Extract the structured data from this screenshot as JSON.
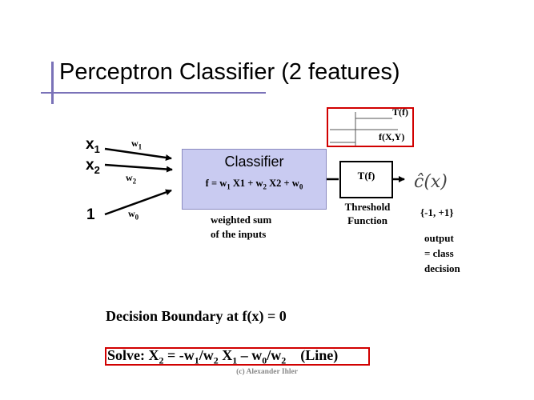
{
  "slide": {
    "title": "Perceptron Classifier (2 features)",
    "copyright": "(c) Alexander Ihler"
  },
  "inputs": [
    {
      "base": "x",
      "sub": "1"
    },
    {
      "base": "x",
      "sub": "2"
    },
    {
      "base": "1",
      "sub": ""
    }
  ],
  "weights": [
    {
      "base": "w",
      "sub": "1"
    },
    {
      "base": "w",
      "sub": "2"
    },
    {
      "base": "w",
      "sub": "0"
    }
  ],
  "classifier": {
    "title": "Classifier",
    "formula": {
      "p1": "f = w",
      "s1": "1",
      "p2": " X1 + w",
      "s2": "2",
      "p3": " X2 + w",
      "s3": "0"
    },
    "caption_line1": "weighted sum",
    "caption_line2": "of the inputs"
  },
  "threshold": {
    "box_label": "T(f)",
    "caption_line1": "Threshold",
    "caption_line2": "Function"
  },
  "step_inset": {
    "t_label": "T(f)",
    "f_label": "f(X,Y)"
  },
  "output": {
    "symbol": "ĉ(x)",
    "range": "{-1, +1}",
    "line1": "output",
    "line2": "= class",
    "line3": "decision"
  },
  "decision_boundary": "Decision Boundary at  f(x) = 0",
  "solve": {
    "p1": "Solve:  X",
    "s1": "2",
    "p2": " = -w",
    "s2": "1",
    "p3": "/w",
    "s3": "2",
    "p4": " X",
    "s4": "1",
    "p5": " – w",
    "s5": "0",
    "p6": "/w",
    "s6": "2",
    "p7": "    (Line)"
  },
  "colors": {
    "title_rule": "#7a72b8",
    "classifier_fill": "#c9cbf1",
    "highlight_box": "#d10000"
  }
}
